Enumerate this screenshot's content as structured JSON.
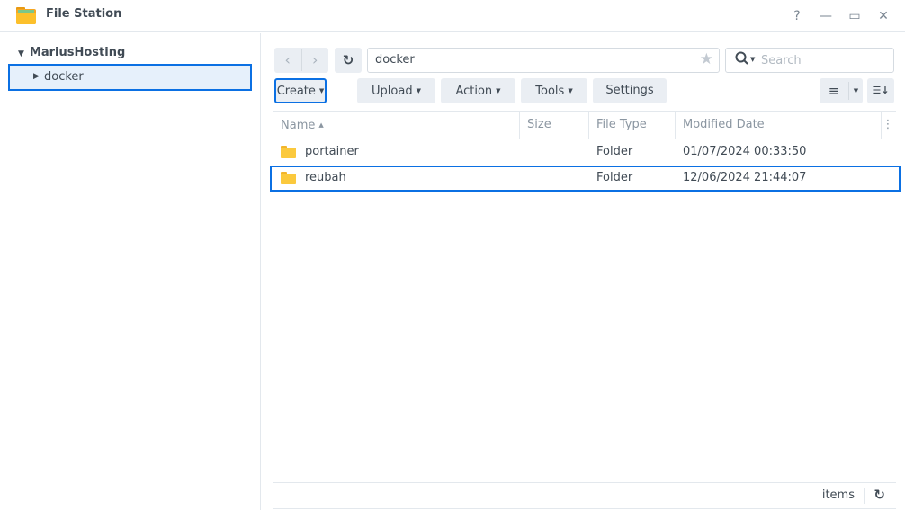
{
  "window": {
    "title": "File Station",
    "help_icon": "?",
    "minimize_icon": "—",
    "maximize_icon": "▭",
    "close_icon": "✕"
  },
  "sidebar": {
    "root_label": "MariusHosting",
    "items": [
      {
        "label": "docker",
        "selected": true
      }
    ]
  },
  "toolbar": {
    "back_icon": "‹",
    "forward_icon": "›",
    "refresh_icon": "↻",
    "path": "docker",
    "favorite_icon": "★",
    "search_icon": "⚲",
    "search_placeholder": "Search",
    "buttons": [
      {
        "label": "Create",
        "dropdown": "▼"
      },
      {
        "label": "Upload",
        "dropdown": "▼"
      },
      {
        "label": "Action",
        "dropdown": "▼"
      },
      {
        "label": "Tools",
        "dropdown": "▼"
      },
      {
        "label": "Settings"
      }
    ],
    "view_icon": "≡",
    "view_dropdown": "▼",
    "sort_icon": "☰↓"
  },
  "grid": {
    "columns": [
      {
        "label": "Name",
        "sort": "▲"
      },
      {
        "label": "Size"
      },
      {
        "label": "File Type"
      },
      {
        "label": "Modified Date"
      }
    ],
    "column_menu_icon": "⋮",
    "rows": [
      {
        "name": "portainer",
        "size": "",
        "type": "Folder",
        "modified": "01/07/2024 00:33:50",
        "selected": false
      },
      {
        "name": "reubah",
        "size": "",
        "type": "Folder",
        "modified": "12/06/2024 21:44:07",
        "selected": true
      }
    ]
  },
  "status": {
    "items_label": "items",
    "refresh_icon": "↻"
  },
  "colors": {
    "accent": "#0b70e3",
    "selection_bg": "#e6f0fb",
    "button_bg": "#eaeef3",
    "folder": "#fbc93d"
  }
}
